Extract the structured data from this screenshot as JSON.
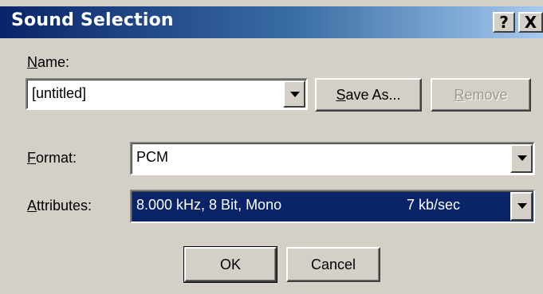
{
  "window": {
    "title": "Sound Selection",
    "help_label": "?",
    "close_label": "X"
  },
  "name": {
    "label_hotkey": "N",
    "label_rest": "ame:",
    "value": "[untitled]"
  },
  "buttons": {
    "save_as_hotkey": "S",
    "save_as_rest": "ave As...",
    "remove_hotkey": "R",
    "remove_rest": "emove",
    "ok": "OK",
    "cancel": "Cancel"
  },
  "format": {
    "label_hotkey": "F",
    "label_rest": "ormat:",
    "value": "PCM"
  },
  "attributes": {
    "label_hotkey": "A",
    "label_rest": "ttributes:",
    "value": "8.000 kHz, 8 Bit, Mono",
    "rate": "7 kb/sec"
  },
  "colors": {
    "title_bar": "#0a246a",
    "selection": "#0a246a",
    "face": "#d4d0c8"
  }
}
